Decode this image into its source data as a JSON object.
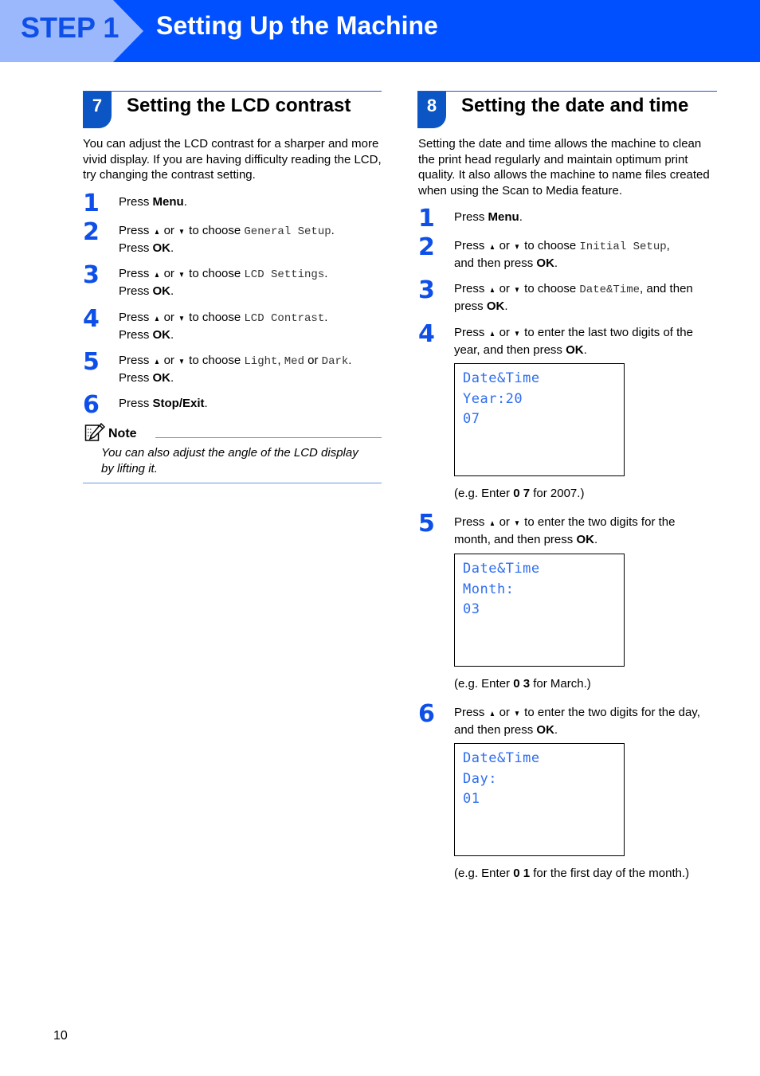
{
  "banner": {
    "step_label": "STEP 1",
    "title": "Setting Up the Machine",
    "colors": {
      "bar": "#0050ff",
      "step_panel": "#9ab8fb",
      "step_text": "#0d4fe8"
    }
  },
  "section_lcd": {
    "number": "7",
    "title": "Setting the LCD contrast",
    "intro": "You can adjust the LCD contrast for a sharper and more vivid display. If you are having difficulty reading the LCD, try changing the contrast setting.",
    "steps": [
      {
        "num": "1",
        "line1": [
          "Press ",
          {
            "b": "Menu"
          },
          "."
        ]
      },
      {
        "num": "2",
        "line1": [
          "Press ",
          {
            "up": "▲"
          },
          " or ",
          {
            "down": "▼"
          },
          " to choose ",
          {
            "m": "General Setup"
          },
          "."
        ],
        "line2": [
          "Press ",
          {
            "b": "OK"
          },
          "."
        ]
      },
      {
        "num": "3",
        "line1": [
          "Press ",
          {
            "up": "▲"
          },
          " or ",
          {
            "down": "▼"
          },
          " to choose ",
          {
            "m": "LCD Settings"
          },
          "."
        ],
        "line2": [
          "Press ",
          {
            "b": "OK"
          },
          "."
        ]
      },
      {
        "num": "4",
        "line1": [
          "Press ",
          {
            "up": "▲"
          },
          " or ",
          {
            "down": "▼"
          },
          " to choose ",
          {
            "m": "LCD Contrast"
          },
          "."
        ],
        "line2": [
          "Press ",
          {
            "b": "OK"
          },
          "."
        ]
      },
      {
        "num": "5",
        "line1": [
          "Press ",
          {
            "up": "▲"
          },
          " or ",
          {
            "down": "▼"
          },
          " to choose ",
          {
            "m": "Light"
          },
          ", ",
          {
            "m": "Med"
          },
          " or ",
          {
            "m": "Dark"
          },
          "."
        ],
        "line2": [
          "Press ",
          {
            "b": "OK"
          },
          "."
        ]
      },
      {
        "num": "6",
        "line1": [
          "Press ",
          {
            "b": "Stop/Exit"
          },
          "."
        ]
      }
    ],
    "note": {
      "label": "Note",
      "text_line1": "You can also adjust the angle of the LCD display",
      "text_line2": "by lifting it."
    }
  },
  "section_date": {
    "number": "8",
    "title": "Setting the date and time",
    "intro": "Setting the date and time allows the machine to clean the print head regularly and maintain optimum print quality. It also allows the machine to name files created when using the Scan to Media feature.",
    "steps": [
      {
        "num": "1",
        "line1": [
          "Press ",
          {
            "b": "Menu"
          },
          "."
        ]
      },
      {
        "num": "2",
        "line1": [
          "Press ",
          {
            "up": "▲"
          },
          " or ",
          {
            "down": "▼"
          },
          " to choose ",
          {
            "m": "Initial Setup"
          },
          ","
        ],
        "line2": [
          "and then press ",
          {
            "b": "OK"
          },
          "."
        ]
      },
      {
        "num": "3",
        "line1": [
          "Press ",
          {
            "up": "▲"
          },
          " or ",
          {
            "down": "▼"
          },
          " to choose ",
          {
            "m": "Date&Time"
          },
          ", and then"
        ],
        "line2": [
          "press ",
          {
            "b": "OK"
          },
          "."
        ]
      },
      {
        "num": "4",
        "line1": [
          "Press ",
          {
            "up": "▲"
          },
          " or ",
          {
            "down": "▼"
          },
          " to enter the last two digits of the"
        ],
        "line2": [
          "year, and then press ",
          {
            "b": "OK"
          },
          "."
        ]
      },
      {
        "num": "5",
        "line1": [
          "Press ",
          {
            "up": "▲"
          },
          " or ",
          {
            "down": "▼"
          },
          " to enter the two digits for the"
        ],
        "line2": [
          "month, and then press ",
          {
            "b": "OK"
          },
          "."
        ]
      },
      {
        "num": "6",
        "line1": [
          "Press ",
          {
            "up": "▲"
          },
          " or ",
          {
            "down": "▼"
          },
          " to enter the two digits for the day,"
        ],
        "line2": [
          "and then press ",
          {
            "b": "OK"
          },
          "."
        ]
      }
    ],
    "lcd_screens": [
      {
        "lines": [
          "Date&Time",
          "Year:20",
          "07"
        ],
        "caption": [
          "(e.g. Enter ",
          {
            "b": "0 7"
          },
          " for 2007.)"
        ]
      },
      {
        "lines": [
          "Date&Time",
          "Month:",
          "03"
        ],
        "caption": [
          "(e.g. Enter ",
          {
            "b": "0 3"
          },
          " for March.)"
        ]
      },
      {
        "lines": [
          "Date&Time",
          "Day:",
          "01"
        ],
        "caption": [
          "(e.g. Enter ",
          {
            "b": "0 1"
          },
          " for the first day of the month.)"
        ]
      }
    ]
  },
  "footer": {
    "page_number": "10"
  }
}
